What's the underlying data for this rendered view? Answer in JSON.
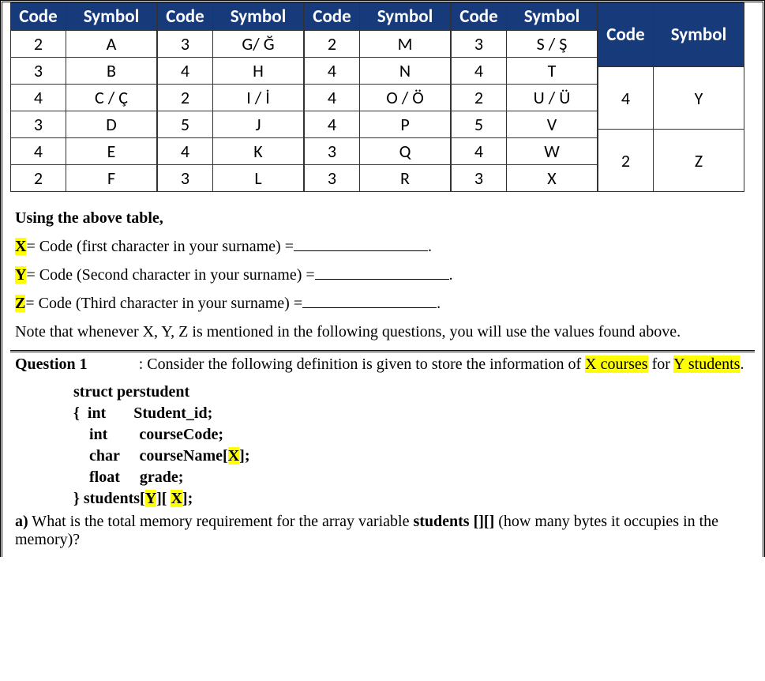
{
  "headers": {
    "code": "Code",
    "symbol": "Symbol"
  },
  "columns": [
    {
      "rows": [
        {
          "c": "2",
          "s": "A"
        },
        {
          "c": "3",
          "s": "B"
        },
        {
          "c": "4",
          "s": "C / Ç"
        },
        {
          "c": "3",
          "s": "D"
        },
        {
          "c": "4",
          "s": "E"
        },
        {
          "c": "2",
          "s": "F"
        }
      ]
    },
    {
      "rows": [
        {
          "c": "3",
          "s": "G/ Ğ"
        },
        {
          "c": "4",
          "s": "H"
        },
        {
          "c": "2",
          "s": "I / İ"
        },
        {
          "c": "5",
          "s": "J"
        },
        {
          "c": "4",
          "s": "K"
        },
        {
          "c": "3",
          "s": "L"
        }
      ]
    },
    {
      "rows": [
        {
          "c": "2",
          "s": "M"
        },
        {
          "c": "4",
          "s": "N"
        },
        {
          "c": "4",
          "s": "O / Ö"
        },
        {
          "c": "4",
          "s": "P"
        },
        {
          "c": "3",
          "s": "Q"
        },
        {
          "c": "3",
          "s": "R"
        }
      ]
    },
    {
      "rows": [
        {
          "c": "3",
          "s": "S / Ş"
        },
        {
          "c": "4",
          "s": "T"
        },
        {
          "c": "2",
          "s": "U / Ü"
        },
        {
          "c": "5",
          "s": "V"
        },
        {
          "c": "4",
          "s": "W"
        },
        {
          "c": "3",
          "s": "X"
        }
      ]
    },
    {
      "rows": [
        {
          "c": "4",
          "s": "Y"
        },
        {
          "c": "2",
          "s": "Z"
        }
      ]
    }
  ],
  "instructions": {
    "using": "Using the above table,",
    "x_var": "X",
    "x_text": "= Code (first character in your surname) =",
    "y_var": "Y",
    "y_text": "= Code (Second character in your surname) =",
    "z_var": "Z",
    "z_text": "= Code (Third character in your surname) =",
    "dot": ".",
    "note": "Note that whenever X, Y, Z is mentioned in the following questions, you will use the values found above."
  },
  "question": {
    "label": "Question 1",
    "colon_text": ": Consider the following definition is given to store the information of ",
    "xcourses": "X courses",
    "for_text": " for ",
    "ystudents": "Y students",
    "end_dot": ".",
    "struct_l1": "struct perstudent",
    "struct_l2": "{  int       Student_id;",
    "struct_l3": "    int        courseCode;",
    "struct_l4a": "    char     courseName[",
    "struct_l4b": "X",
    "struct_l4c": "];",
    "struct_l5": "    float     grade;",
    "struct_l6a": "} students[",
    "struct_l6b": "Y",
    "struct_l6c": "][ ",
    "struct_l6d": "X",
    "struct_l6e": "];",
    "parta_label": "a)",
    "parta_text1": " What is the total memory requirement for the array variable ",
    "parta_bold": "students [][]",
    "parta_text2": " (how many bytes it occupies in the memory)?"
  }
}
